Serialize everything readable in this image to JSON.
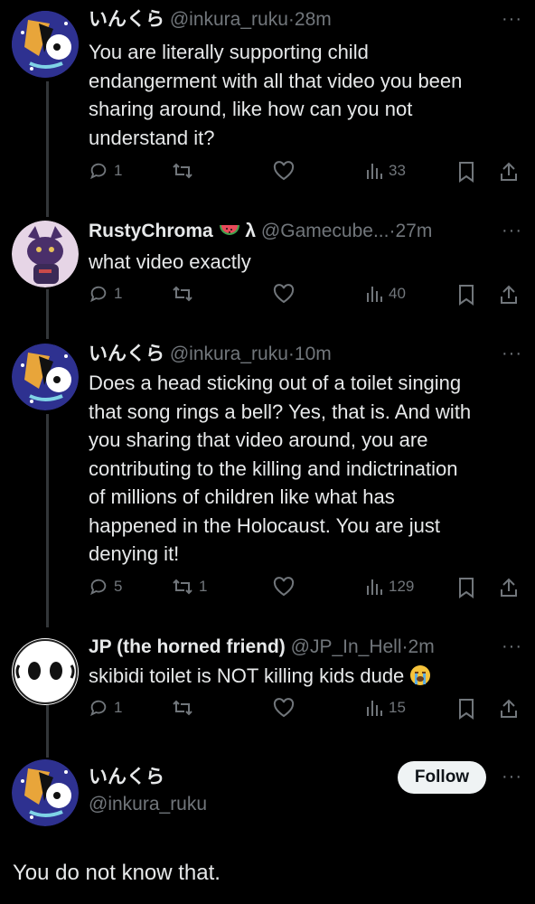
{
  "tweets": [
    {
      "name": "いんくら",
      "handle": "@inkura_ruku",
      "time": "28m",
      "lines": [
        "You are literally supporting child",
        "endangerment with all that video you been",
        "sharing around, like how can you not",
        "understand it?"
      ],
      "replies": "1",
      "reposts": "",
      "views": "33"
    },
    {
      "name": "RustyChroma",
      "name_suffix": "λ",
      "handle": "@Gamecube...",
      "time": "27m",
      "lines": [
        "what video exactly"
      ],
      "replies": "1",
      "reposts": "",
      "views": "40"
    },
    {
      "name": "いんくら",
      "handle": "@inkura_ruku",
      "time": "10m",
      "lines": [
        "Does a head sticking out of a toilet singing",
        "that song rings a bell? Yes, that is. And with",
        "you sharing that video around, you are",
        "contributing to the killing and indictrination",
        "of millions of children like what has",
        "happened in the Holocaust. You are just",
        "denying it!"
      ],
      "replies": "5",
      "reposts": "1",
      "views": "129"
    },
    {
      "name": "JP (the horned friend)",
      "handle": "@JP_In_Hell",
      "time": "2m",
      "lines": [
        "skibidi toilet is NOT killing kids dude"
      ],
      "replies": "1",
      "reposts": "",
      "views": "15"
    }
  ],
  "focus": {
    "name": "いんくら",
    "handle": "@inkura_ruku",
    "follow_label": "Follow",
    "text": "You do not know that."
  },
  "sep": "·",
  "more": "···",
  "icons": [
    "reply-icon",
    "repost-icon",
    "like-icon",
    "views-icon",
    "bookmark-icon",
    "share-icon",
    "watermelon-icon",
    "sob-emoji-icon"
  ],
  "colors": {
    "bg": "#000000",
    "text": "#e7e9ea",
    "muted": "#71767b",
    "follow_bg": "#eff3f4"
  }
}
